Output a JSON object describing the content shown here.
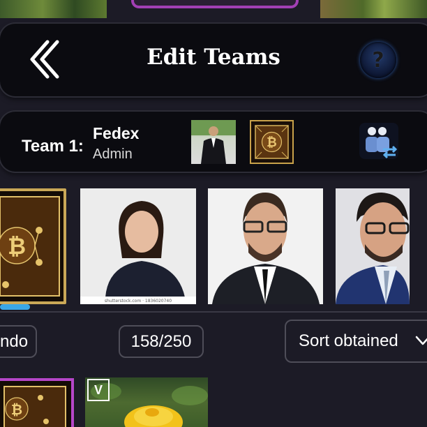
{
  "header": {
    "title": "Edit Teams",
    "back_icon": "double-chevron-left-icon",
    "help_label": "?"
  },
  "team": {
    "label": "Team 1:",
    "name": "Fedex",
    "role": "Admin",
    "swap_icon": "swap-users-icon"
  },
  "cards": [
    {
      "kind": "bitcoin-frame"
    },
    {
      "kind": "photo",
      "caption": "shutterstock.com · 1836020740"
    },
    {
      "kind": "photo"
    },
    {
      "kind": "photo"
    }
  ],
  "progress": {
    "fraction": 0.07
  },
  "controls": {
    "filter_label": "ndo",
    "count_label": "158/250",
    "sort_label": "Sort obtained"
  },
  "bottom": {
    "badge_label": "V"
  },
  "colors": {
    "panel_bg": "#0b0b10",
    "page_bg": "#1c1b26",
    "accent_blue": "#3aa7e6",
    "gold": "#caa857",
    "purple": "#b646c9"
  }
}
